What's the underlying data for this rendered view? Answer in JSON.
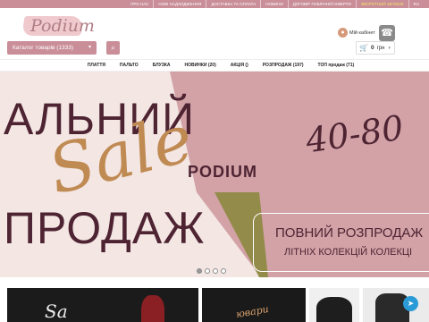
{
  "topbar": {
    "links": [
      "ПРО НАС",
      "НОВІ НАДХОДЖЕННЯ",
      "ДОСТАВКА ТА ОПЛАТА",
      "НОВИНИ",
      "ДОГОВІР ПУБЛІЧНОЇ ОФЕРТИ"
    ],
    "highlight": "ЗВОРОТНИЙ ЗВ'ЯЗОК",
    "lang": "RU"
  },
  "header": {
    "logo_text": "Podium",
    "catalog_label": "Каталог товарів (1333)",
    "account_label": "Мій кабінет",
    "cart_amount": "0",
    "cart_currency": "грн"
  },
  "nav": {
    "items": [
      "ПЛАТТЯ",
      "ПАЛЬТО",
      "БЛУЗКА",
      "НОВИНКИ (20)",
      "АКЦІЯ ()",
      "РОЗПРОДАЖ (197)",
      "ТОП продаж (71)"
    ]
  },
  "banner": {
    "big_top": "АЛЬНИЙ",
    "script": "Sale",
    "big_bottom": "ПРОДАЖ",
    "percent": "40-80",
    "brand": "PODIUM",
    "line1": "ПОВНИЙ РОЗПРОДАЖ",
    "line2": "ЛІТНІХ КОЛЕКЦІЙ КОЛЕКЦІ",
    "slides": 4,
    "active_slide": 0
  },
  "tiles": {
    "tile1_script": "Sa",
    "tile2_script": "ювари"
  },
  "colors": {
    "accent": "#c98e98",
    "banner_rose": "#d2a2a6",
    "banner_text": "#4e2433",
    "telegram": "#2a9bd6"
  },
  "icons": {
    "search": "search-icon",
    "phone": "phone-icon",
    "cart": "cart-icon",
    "account": "user-icon",
    "telegram": "telegram-icon"
  }
}
